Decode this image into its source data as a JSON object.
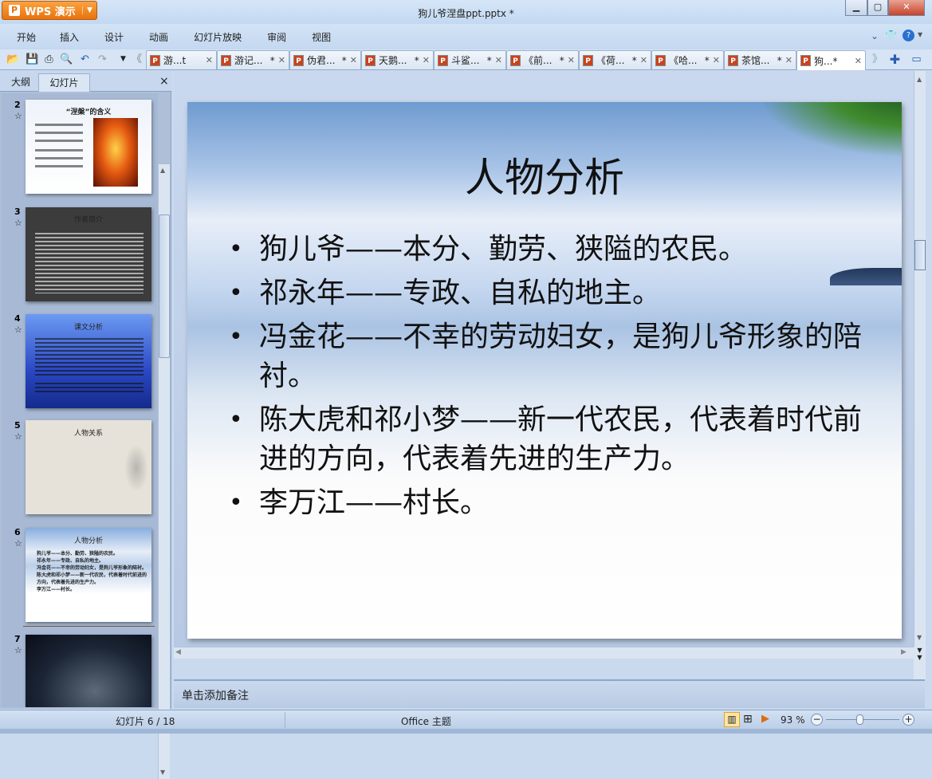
{
  "app": {
    "name": "WPS 演示",
    "title": "狗儿爷涅盘ppt.pptx *"
  },
  "menu": [
    "开始",
    "插入",
    "设计",
    "动画",
    "幻灯片放映",
    "审阅",
    "视图"
  ],
  "tabs": [
    {
      "label": "游...t",
      "modified": ""
    },
    {
      "label": "游记...",
      "modified": "*"
    },
    {
      "label": "伪君...",
      "modified": "*"
    },
    {
      "label": "天鹅...",
      "modified": "*"
    },
    {
      "label": "斗鲨...",
      "modified": "*"
    },
    {
      "label": "《前...",
      "modified": "*"
    },
    {
      "label": "《荷...",
      "modified": "*"
    },
    {
      "label": "《哈...",
      "modified": "*"
    },
    {
      "label": "茶馆...",
      "modified": "*"
    },
    {
      "label": "狗...*",
      "modified": ""
    }
  ],
  "panel": {
    "tab_outline": "大纲",
    "tab_slides": "幻灯片",
    "close": "×"
  },
  "thumbnails": [
    {
      "num": "2",
      "title": "“涅槃”的含义"
    },
    {
      "num": "3",
      "title": "作者简介"
    },
    {
      "num": "4",
      "title": "课文分析"
    },
    {
      "num": "5",
      "title": "人物关系"
    },
    {
      "num": "6",
      "title": "人物分析"
    },
    {
      "num": "7",
      "title": ""
    }
  ],
  "slide": {
    "title": "人物分析",
    "bullets": [
      "狗儿爷——本分、勤劳、狭隘的农民。",
      "祁永年——专政、自私的地主。",
      "冯金花——不幸的劳动妇女，是狗儿爷形象的陪衬。",
      "陈大虎和祁小梦——新一代农民，代表着时代前进的方向，代表着先进的生产力。",
      "李万江——村长。"
    ]
  },
  "notes": {
    "placeholder": "单击添加备注"
  },
  "status": {
    "slide": "幻灯片 6 / 18",
    "theme": "Office 主题",
    "zoom": "93 %",
    "zoom_level": 93
  }
}
